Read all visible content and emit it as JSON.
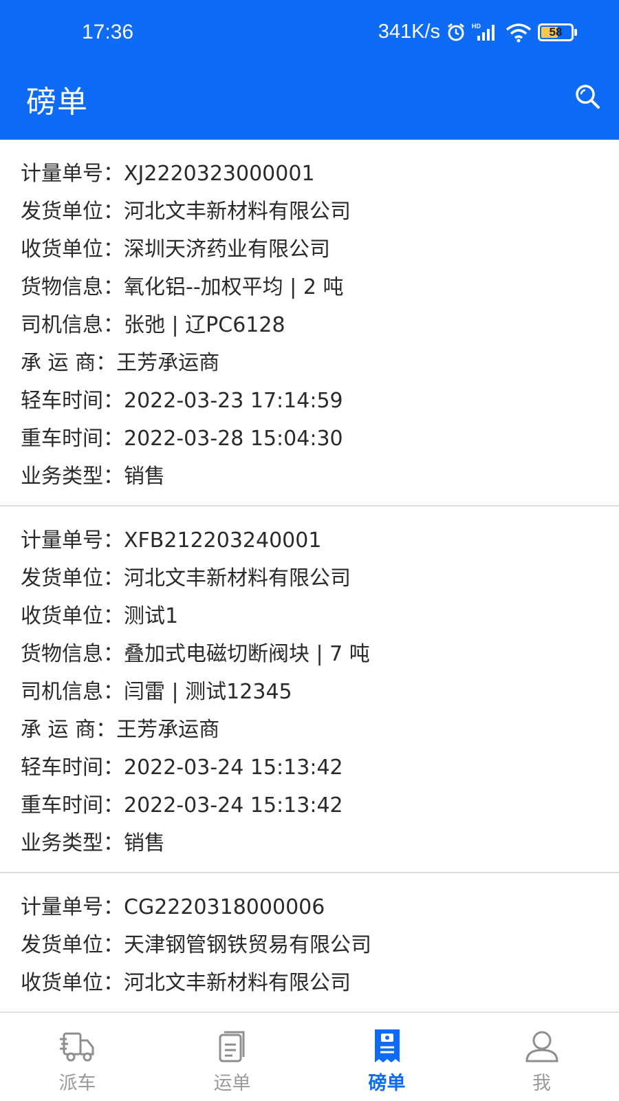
{
  "status_bar": {
    "time": "17:36",
    "network_speed": "341K/s",
    "battery_level": "58",
    "icons": [
      "alarm-icon",
      "hd-signal-icon",
      "wifi-icon",
      "battery-icon"
    ]
  },
  "header": {
    "title": "磅单",
    "search_icon": "search-icon",
    "background_color": "#0e6bf6"
  },
  "records": [
    {
      "fields": [
        {
          "label": "计量单号：",
          "value": "XJ2220323000001"
        },
        {
          "label": "发货单位：",
          "value": "河北文丰新材料有限公司"
        },
        {
          "label": "收货单位：",
          "value": "深圳天济药业有限公司"
        },
        {
          "label": "货物信息：",
          "value": "氧化铝--加权平均 | 2 吨"
        },
        {
          "label": "司机信息：",
          "value": "张弛 | 辽PC6128"
        },
        {
          "label": "承 运 商：",
          "value": "王芳承运商"
        },
        {
          "label": "轻车时间：",
          "value": "2022-03-23 17:14:59"
        },
        {
          "label": "重车时间：",
          "value": "2022-03-28 15:04:30"
        },
        {
          "label": "业务类型：",
          "value": "销售"
        }
      ]
    },
    {
      "fields": [
        {
          "label": "计量单号：",
          "value": "XFB212203240001"
        },
        {
          "label": "发货单位：",
          "value": "河北文丰新材料有限公司"
        },
        {
          "label": "收货单位：",
          "value": "测试1"
        },
        {
          "label": "货物信息：",
          "value": "叠加式电磁切断阀块 | 7 吨"
        },
        {
          "label": "司机信息：",
          "value": "闫雷 | 测试12345"
        },
        {
          "label": "承 运 商：",
          "value": "王芳承运商"
        },
        {
          "label": "轻车时间：",
          "value": "2022-03-24 15:13:42"
        },
        {
          "label": "重车时间：",
          "value": "2022-03-24 15:13:42"
        },
        {
          "label": "业务类型：",
          "value": "销售"
        }
      ]
    },
    {
      "fields": [
        {
          "label": "计量单号：",
          "value": "CG2220318000006"
        },
        {
          "label": "发货单位：",
          "value": "天津钢管钢铁贸易有限公司"
        },
        {
          "label": "收货单位：",
          "value": "河北文丰新材料有限公司"
        }
      ]
    }
  ],
  "tabbar": {
    "tabs": [
      {
        "label": "派车",
        "icon": "truck-icon",
        "active": false
      },
      {
        "label": "运单",
        "icon": "document-icon",
        "active": false
      },
      {
        "label": "磅单",
        "icon": "weigh-ticket-icon",
        "active": true
      },
      {
        "label": "我",
        "icon": "user-icon",
        "active": false
      }
    ],
    "active_color": "#0e6bf6",
    "inactive_color": "#9a9a9a"
  }
}
